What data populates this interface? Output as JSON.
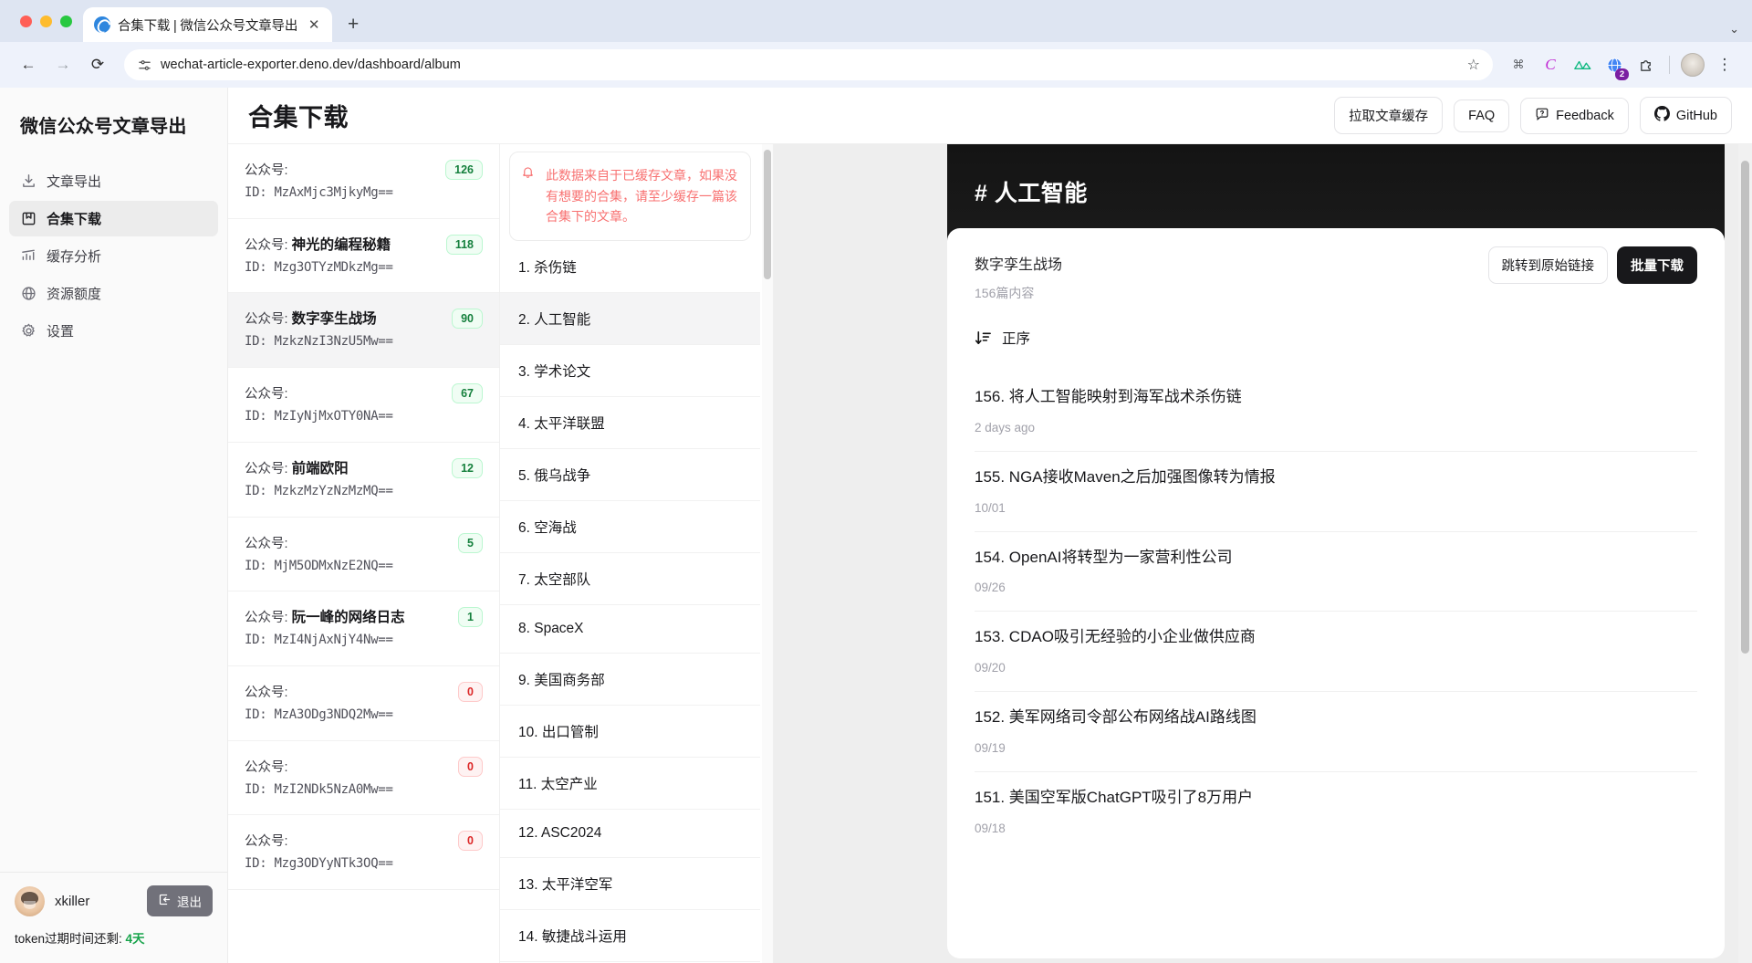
{
  "browser": {
    "tab": {
      "title": "合集下载 | 微信公众号文章导出",
      "close_label": "✕",
      "favicon": "wechat-exporter-favicon"
    },
    "newtab_label": "+",
    "tabstrip_chevron": "⌄",
    "nav": {
      "back": "←",
      "forward": "→",
      "reload": "⟳"
    },
    "omnibox": {
      "url": "wechat-article-exporter.deno.dev/dashboard/album",
      "site_icon": "tune-icon",
      "star": "☆"
    },
    "extensions": [
      {
        "name": "command-extension-icon",
        "glyph": "⌘",
        "color": "#5f6368"
      },
      {
        "name": "c-extension-icon",
        "glyph": "C",
        "color": "#c026d3"
      },
      {
        "name": "mountain-extension-icon",
        "glyph": "⛰",
        "color": "#10b981"
      },
      {
        "name": "globe-extension-icon",
        "glyph": "🌐",
        "color": "#2563eb",
        "badge": "2"
      }
    ],
    "puzzle_icon": "⧉",
    "menu_icon": "⋮"
  },
  "sidebar": {
    "brand": "微信公众号文章导出",
    "items": [
      {
        "label": "文章导出",
        "icon": "download-icon",
        "active": false
      },
      {
        "label": "合集下载",
        "icon": "bookmark-icon",
        "active": true
      },
      {
        "label": "缓存分析",
        "icon": "chart-icon",
        "active": false
      },
      {
        "label": "资源额度",
        "icon": "globe-icon",
        "active": false
      },
      {
        "label": "设置",
        "icon": "gear-icon",
        "active": false
      }
    ],
    "user": {
      "name": "xkiller",
      "logout_label": "退出",
      "logout_icon": "logout-icon"
    },
    "token": {
      "prefix": "token过期时间还剩:",
      "value": "4天"
    }
  },
  "topbar": {
    "title": "合集下载",
    "buttons": [
      {
        "label": "拉取文章缓存",
        "icon": null
      },
      {
        "label": "FAQ",
        "icon": null
      },
      {
        "label": "Feedback",
        "icon": "feedback-icon"
      },
      {
        "label": "GitHub",
        "icon": "github-icon"
      }
    ]
  },
  "accounts": [
    {
      "prefix": "公众号:",
      "name": "",
      "id": "ID: MzAxMjc3MjkyMg==",
      "count": "126",
      "active": false
    },
    {
      "prefix": "公众号:",
      "name": "神光的编程秘籍",
      "id": "ID: Mzg3OTYzMDkzMg==",
      "count": "118",
      "active": false
    },
    {
      "prefix": "公众号:",
      "name": "数字孪生战场",
      "id": "ID: MzkzNzI3NzU5Mw==",
      "count": "90",
      "active": true
    },
    {
      "prefix": "公众号:",
      "name": "",
      "id": "ID: MzIyNjMxOTY0NA==",
      "count": "67",
      "active": false
    },
    {
      "prefix": "公众号:",
      "name": "前端欧阳",
      "id": "ID: MzkzMzYzNzMzMQ==",
      "count": "12",
      "active": false
    },
    {
      "prefix": "公众号:",
      "name": "",
      "id": "ID: MjM5ODMxNzE2NQ==",
      "count": "5",
      "active": false
    },
    {
      "prefix": "公众号:",
      "name": "阮一峰的网络日志",
      "id": "ID: MzI4NjAxNjY4Nw==",
      "count": "1",
      "active": false
    },
    {
      "prefix": "公众号:",
      "name": "",
      "id": "ID: MzA3ODg3NDQ2Mw==",
      "count": "0",
      "active": false
    },
    {
      "prefix": "公众号:",
      "name": "",
      "id": "ID: MzI2NDk5NzA0Mw==",
      "count": "0",
      "active": false
    },
    {
      "prefix": "公众号:",
      "name": "",
      "id": "ID: Mzg3ODYyNTk3OQ==",
      "count": "0",
      "active": false
    }
  ],
  "albums": {
    "notice": "此数据来自于已缓存文章，如果没有想要的合集，请至少缓存一篇该合集下的文章。",
    "notice_icon": "bell-icon",
    "items": [
      {
        "label": "1. 杀伤链",
        "active": false
      },
      {
        "label": "2. 人工智能",
        "active": true
      },
      {
        "label": "3. 学术论文",
        "active": false
      },
      {
        "label": "4. 太平洋联盟",
        "active": false
      },
      {
        "label": "5. 俄乌战争",
        "active": false
      },
      {
        "label": "6. 空海战",
        "active": false
      },
      {
        "label": "7. 太空部队",
        "active": false
      },
      {
        "label": "8. SpaceX",
        "active": false
      },
      {
        "label": "9. 美国商务部",
        "active": false
      },
      {
        "label": "10. 出口管制",
        "active": false
      },
      {
        "label": "11. 太空产业",
        "active": false
      },
      {
        "label": "12. ASC2024",
        "active": false
      },
      {
        "label": "13. 太平洋空军",
        "active": false
      },
      {
        "label": "14. 敏捷战斗运用",
        "active": false
      }
    ]
  },
  "detail": {
    "hero_title": "# 人工智能",
    "owner": "数字孪生战场",
    "count": "156篇内容",
    "jump_label": "跳转到原始链接",
    "batch_label": "批量下载",
    "sort_label": "正序",
    "sort_icon": "sort-asc-icon",
    "articles": [
      {
        "title": "156. 将人工智能映射到海军战术杀伤链",
        "date": "2 days ago"
      },
      {
        "title": "155. NGA接收Maven之后加强图像转为情报",
        "date": "10/01"
      },
      {
        "title": "154. OpenAI将转型为一家营利性公司",
        "date": "09/26"
      },
      {
        "title": "153. CDAO吸引无经验的小企业做供应商",
        "date": "09/20"
      },
      {
        "title": "152. 美军网络司令部公布网络战AI路线图",
        "date": "09/19"
      },
      {
        "title": "151. 美国空军版ChatGPT吸引了8万用户",
        "date": "09/18"
      }
    ]
  },
  "colors": {
    "accent_green": "#15803d",
    "accent_red": "#f87171",
    "dark": "#18181b",
    "token_green": "#16a34a"
  }
}
